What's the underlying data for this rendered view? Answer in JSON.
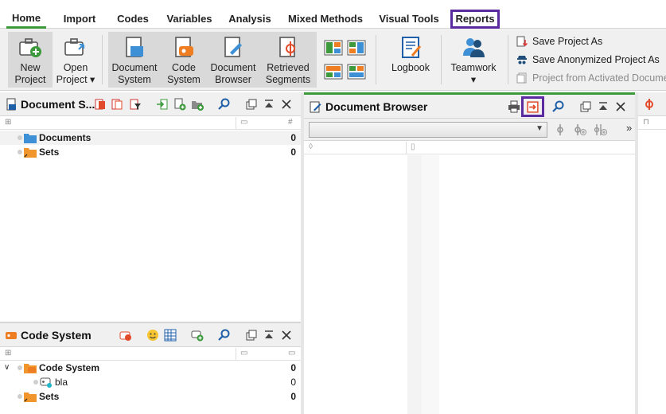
{
  "menu": {
    "tabs": [
      "Home",
      "Import",
      "Codes",
      "Variables",
      "Analysis",
      "Mixed Methods",
      "Visual Tools",
      "Reports"
    ],
    "active": "Home",
    "highlighted": "Reports"
  },
  "ribbon": {
    "new_project": "New\nProject",
    "open_project": "Open\nProject ▾",
    "document_system": "Document\nSystem",
    "code_system": "Code\nSystem",
    "document_browser": "Document\nBrowser",
    "retrieved_segments": "Retrieved\nSegments",
    "logbook": "Logbook",
    "teamwork": "Teamwork\n▾",
    "save_project_as": "Save Project As",
    "save_anonymized": "Save Anonymized Project As",
    "project_from_activated": "Project from Activated Docume"
  },
  "document_system": {
    "title": "Document S...",
    "rows": [
      {
        "name": "Documents",
        "count": "0"
      },
      {
        "name": "Sets",
        "count": "0"
      }
    ]
  },
  "code_system": {
    "title": "Code System",
    "rows": [
      {
        "name": "Code System",
        "count": "0"
      },
      {
        "name": "bla",
        "count": "0"
      },
      {
        "name": "Sets",
        "count": "0"
      }
    ]
  },
  "document_browser": {
    "title": "Document Browser",
    "selector_value": ""
  },
  "colors": {
    "accent_green": "#3c9a3c",
    "highlight_purple": "#5b2aa0",
    "folder_blue": "#3d8fd6",
    "folder_orange": "#f0962d",
    "code_orange": "#ef7d22"
  }
}
